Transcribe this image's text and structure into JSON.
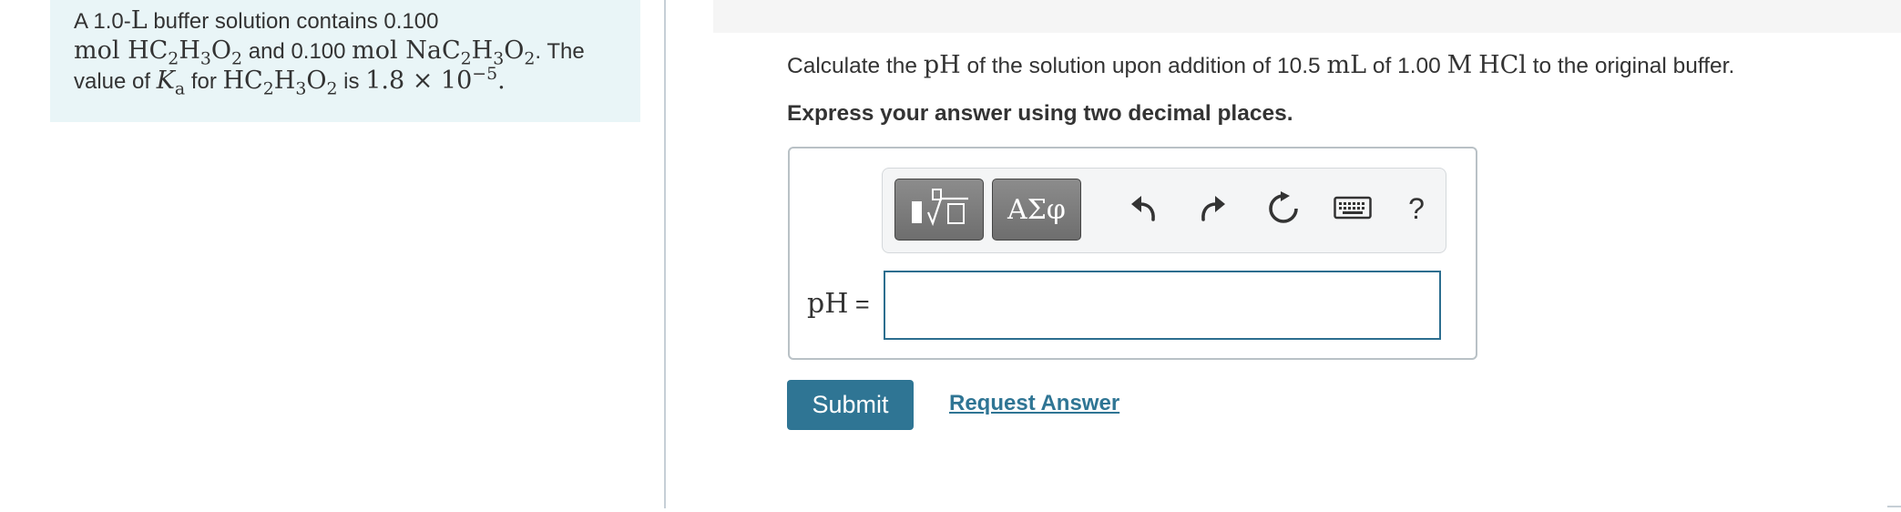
{
  "problem": {
    "line1_prefix": "A 1.0-",
    "line1_unit": "L",
    "line1_suffix": " buffer solution contains 0.100",
    "line2_mol1": "mol HC",
    "line2_sub1": "2",
    "line2_h1": "H",
    "line2_sub2": "3",
    "line2_o1": "O",
    "line2_sub3": "2",
    "line2_and": " and 0.100 ",
    "line2_mol2": "mol NaC",
    "line2_sub4": "2",
    "line2_h2": "H",
    "line2_sub5": "3",
    "line2_o2": "O",
    "line2_sub6": "2",
    "line2_end": ". The",
    "line3_prefix": "value of ",
    "line3_k": "K",
    "line3_ksub": "a",
    "line3_for": " for ",
    "line3_hc": "HC",
    "line3_sub1": "2",
    "line3_h": "H",
    "line3_sub2": "3",
    "line3_o": "O",
    "line3_sub3": "2",
    "line3_is": " is ",
    "line3_val": "1.8 × 10",
    "line3_exp": "−5",
    "line3_period": "."
  },
  "question": {
    "part1": "Calculate the ",
    "ph": "pH",
    "part2": " of the solution upon addition of 10.5 ",
    "ml": "mL",
    "part3": " of 1.00 ",
    "m": "M",
    "space": " ",
    "hcl": "HCl",
    "part4": " to the original buffer."
  },
  "instruction": "Express your answer using two decimal places.",
  "toolbar": {
    "symbols_label": "ΑΣφ",
    "help_label": "?",
    "icons": [
      "templates-icon",
      "undo-icon",
      "redo-icon",
      "reset-icon",
      "keyboard-icon",
      "help-icon"
    ]
  },
  "answer": {
    "label_math": "pH",
    "label_eq": " =",
    "input_value": ""
  },
  "actions": {
    "submit_label": "Submit",
    "request_label": "Request Answer"
  },
  "colors": {
    "panel_bg": "#e9f5f7",
    "accent": "#2f7594",
    "input_border": "#2c6e8f"
  }
}
